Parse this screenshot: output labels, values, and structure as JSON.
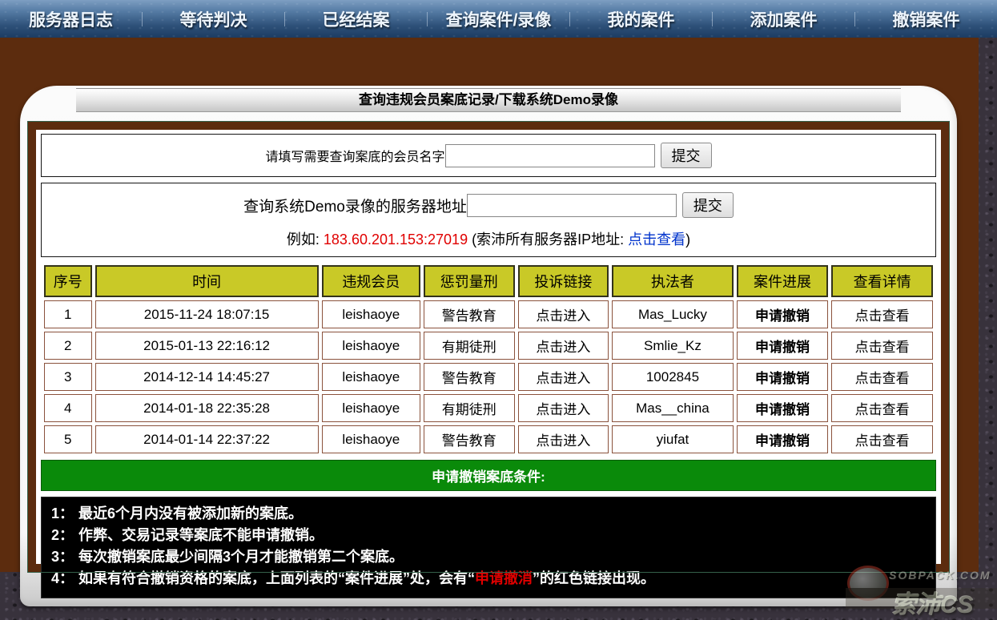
{
  "nav": {
    "items": [
      "服务器日志",
      "等待判决",
      "已经结案",
      "查询案件/录像",
      "我的案件",
      "添加案件",
      "撤销案件"
    ]
  },
  "titlebar": {
    "title": "查询违规会员案底记录/下载系统Demo录像"
  },
  "form": {
    "member_query": {
      "label": "请填写需要查询案底的会员名字",
      "value": "",
      "submit_label": "提交"
    },
    "demo_query": {
      "label": "查询系统Demo录像的服务器地址",
      "value": "",
      "submit_label": "提交"
    },
    "example": {
      "prefix": "例如: ",
      "ip": "183.60.201.153:27019",
      "middle": " (索沛所有服务器IP地址: ",
      "link": "点击查看",
      "suffix": ")"
    }
  },
  "table": {
    "headers": [
      "序号",
      "时间",
      "违规会员",
      "惩罚量刑",
      "投诉链接",
      "执法者",
      "案件进展",
      "查看详情"
    ],
    "rows": [
      {
        "index": "1",
        "time": "2015-11-24 18:07:15",
        "member": "leishaoye",
        "punishment": "警告教育",
        "complaint": "点击进入",
        "enforcer": "Mas_Lucky",
        "progress": "申请撤销",
        "detail": "点击查看"
      },
      {
        "index": "2",
        "time": "2015-01-13 22:16:12",
        "member": "leishaoye",
        "punishment": "有期徒刑",
        "complaint": "点击进入",
        "enforcer": "Smlie_Kz",
        "progress": "申请撤销",
        "detail": "点击查看"
      },
      {
        "index": "3",
        "time": "2014-12-14 14:45:27",
        "member": "leishaoye",
        "punishment": "警告教育",
        "complaint": "点击进入",
        "enforcer": "1002845",
        "progress": "申请撤销",
        "detail": "点击查看"
      },
      {
        "index": "4",
        "time": "2014-01-18 22:35:28",
        "member": "leishaoye",
        "punishment": "有期徒刑",
        "complaint": "点击进入",
        "enforcer": "Mas__china",
        "progress": "申请撤销",
        "detail": "点击查看"
      },
      {
        "index": "5",
        "time": "2014-01-14 22:37:22",
        "member": "leishaoye",
        "punishment": "警告教育",
        "complaint": "点击进入",
        "enforcer": "yiufat",
        "progress": "申请撤销",
        "detail": "点击查看"
      }
    ]
  },
  "conditions": {
    "title": "申请撤销案底条件:",
    "items": [
      {
        "label": "1：",
        "text": "最近6个月内没有被添加新的案底。"
      },
      {
        "label": "2：",
        "text": "作弊、交易记录等案底不能申请撤销。"
      },
      {
        "label": "3：",
        "text": "每次撤销案底最少间隔3个月才能撤销第二个案底。"
      },
      {
        "label": "4：",
        "prefix": "如果有符合撤销资格的案底，上面列表的“案件进展”处，会有“",
        "highlight": "申请撤消",
        "suffix": "”的红色链接出现。"
      }
    ]
  },
  "watermark": {
    "line1": "SOBPACK.COM",
    "line2": "索沛CS"
  },
  "colors": {
    "nav_blue": "#2e5179",
    "frame_brown": "#5c2c0e",
    "header_yellow": "#c9c927",
    "link_blue": "#0000d2",
    "warn_green": "#00a070",
    "prison_orange": "#ffa21c",
    "revoke_red": "#e10000",
    "bar_green": "#0a8a0a"
  }
}
